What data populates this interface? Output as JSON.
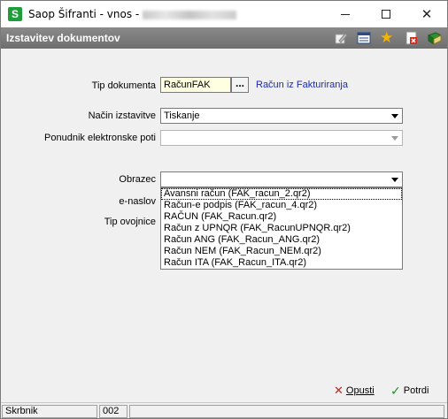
{
  "window": {
    "title": "Saop Šifranti - vnos -",
    "app_icon_letter": "S"
  },
  "header": {
    "title": "Izstavitev dokumentov",
    "icons": [
      "edit-icon",
      "list-icon",
      "star-icon",
      "delete-icon",
      "book-icon"
    ]
  },
  "form": {
    "tip_dokumenta": {
      "label": "Tip dokumenta",
      "value": "RačunFAK",
      "button_label": "...",
      "link": "Račun iz Fakturiranja"
    },
    "nacin_izstavitve": {
      "label": "Način izstavitve",
      "value": "Tiskanje"
    },
    "ponudnik": {
      "label": "Ponudnik elektronske poti",
      "value": ""
    },
    "obrazec": {
      "label": "Obrazec",
      "value": "",
      "options": [
        "Avansni račun (FAK_racun_2.qr2)",
        "Račun-e podpis (FAK_racun_4.qr2)",
        "RAČUN (FAK_Racun.qr2)",
        "Račun z UPNQR (FAK_RacunUPNQR.qr2)",
        "Račun ANG (FAK_Racun_ANG.qr2)",
        "Račun NEM (FAK_Racun_NEM.qr2)",
        "Račun ITA (FAK_Racun_ITA.qr2)"
      ]
    },
    "e_naslov": {
      "label": "e-naslov"
    },
    "tip_ovojnice": {
      "label": "Tip ovojnice"
    }
  },
  "buttons": {
    "cancel": "Opusti",
    "ok": "Potrdi"
  },
  "status": {
    "user": "Skrbnik",
    "code": "002",
    "extra": ""
  }
}
